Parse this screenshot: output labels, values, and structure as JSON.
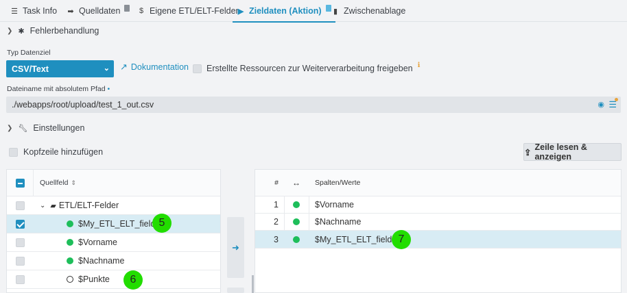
{
  "tabs": [
    {
      "label": "Task Info",
      "icon": "list-icon"
    },
    {
      "label": "Quelldaten",
      "icon": "import-icon"
    },
    {
      "label": "Eigene ETL/ELT-Felder",
      "icon": "dollar-icon"
    },
    {
      "label": "Zieldaten (Aktion)",
      "icon": "play-icon"
    },
    {
      "label": "Zwischenablage",
      "icon": "clipboard-icon"
    }
  ],
  "sections": {
    "error_handling": "Fehlerbehandlung",
    "settings": "Einstellungen"
  },
  "target": {
    "type_label": "Typ Datenziel",
    "type_value": "CSV/Text",
    "doc_link": "Dokumentation",
    "release_label": "Erstellte Ressourcen zur Weiterverarbeitung freigeben",
    "path_label": "Dateiname mit absolutem Pfad",
    "path_required_mark": "•",
    "path_value": "./webapps/root/upload/test_1_out.csv"
  },
  "options": {
    "header_label": "Kopfzeile hinzufügen",
    "read_button": "Zeile lesen & anzeigen"
  },
  "source_table": {
    "header": "Quellfeld",
    "group": "ETL/ELT-Felder",
    "rows": [
      {
        "name": "$My_ETL_ELT_field",
        "checked": true,
        "status": "green"
      },
      {
        "name": "$Vorname",
        "checked": false,
        "status": "green"
      },
      {
        "name": "$Nachname",
        "checked": false,
        "status": "green"
      },
      {
        "name": "$Punkte",
        "checked": false,
        "status": "empty"
      }
    ]
  },
  "target_table": {
    "col_num": "#",
    "col_map": "↔",
    "col_values": "Spalten/Werte",
    "rows": [
      {
        "num": "1",
        "value": "$Vorname"
      },
      {
        "num": "2",
        "value": "$Nachname"
      },
      {
        "num": "3",
        "value": "$My_ETL_ELT_field"
      }
    ]
  },
  "annotations": [
    "5",
    "6",
    "7"
  ],
  "colors": {
    "accent": "#1f8fbf",
    "success": "#1ebe5a",
    "annotation": "#22dd00"
  }
}
